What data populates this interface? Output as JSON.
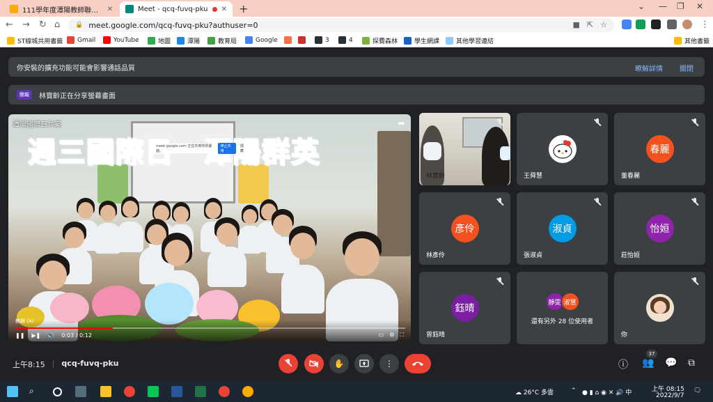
{
  "browser": {
    "tabs": [
      {
        "title": "111學年度潭陽教師聯絡教室",
        "active": false
      },
      {
        "title": "Meet - qcq-fuvq-pku",
        "active": true
      }
    ],
    "url": "meet.google.com/qcq-fuvq-pku?authuser=0",
    "bookmarks": [
      "ST線城共用書籤",
      "Gmail",
      "YouTube",
      "地圖",
      "潭陽",
      "教育局",
      "Google",
      "3",
      "4",
      "探費森林",
      "學生網課",
      "其他學習連結",
      "其他書籤"
    ]
  },
  "banners": {
    "extension_warning": "你安裝的擴充功能可能會影響通話品質",
    "learn_more": "瞭解詳情",
    "close": "關閉",
    "presenting_tag": "簡報",
    "presenting_text": "林寶齡正在分享螢幕畫面"
  },
  "stage": {
    "label": "潭陽國際日共築",
    "title_text": "週三國際日　潭陽群英",
    "popup_text": "meet.google.com 正在共用你的畫面。",
    "popup_stop": "停止共用",
    "popup_hide": "隱藏",
    "teacher_tag": "教師 (A)",
    "time": "0:03 / 0:12",
    "progress": 0.25
  },
  "participants": [
    {
      "name": "林寶齡",
      "type": "camera",
      "muted": true
    },
    {
      "name": "王舜慧",
      "type": "avatar-image",
      "muted": true
    },
    {
      "name": "董春麗",
      "initials": "春麗",
      "color": "#f4511e",
      "muted": true
    },
    {
      "name": "林彥伶",
      "initials": "彥伶",
      "color": "#f4511e",
      "muted": true
    },
    {
      "name": "張淑貞",
      "initials": "淑貞",
      "color": "#039be5",
      "muted": true
    },
    {
      "name": "莊怡姮",
      "initials": "怡姮",
      "color": "#8e24aa",
      "muted": true
    },
    {
      "name": "曾鈺晴",
      "initials": "鈺晴",
      "color": "#7b1fa2",
      "muted": true
    },
    {
      "name": "others",
      "muted": false
    },
    {
      "name": "你",
      "type": "self",
      "muted": true
    }
  ],
  "others_tile": {
    "avatars": [
      {
        "initials": "靜雯",
        "color": "#8e24aa"
      },
      {
        "initials": "淑慧",
        "color": "#f4511e"
      }
    ],
    "text": "還有另外 28 位使用者"
  },
  "meeting": {
    "time": "上午8:15",
    "code": "qcq-fuvq-pku",
    "participant_count": "37"
  },
  "taskbar": {
    "weather": "26°C 多雲",
    "clock_time": "上午 08:15",
    "clock_date": "2022/9/7"
  },
  "colors": {
    "meet_bg": "#202124",
    "tile_bg": "#3c4043",
    "danger_red": "#ea4335",
    "tabstrip": "#f7cfc3"
  }
}
